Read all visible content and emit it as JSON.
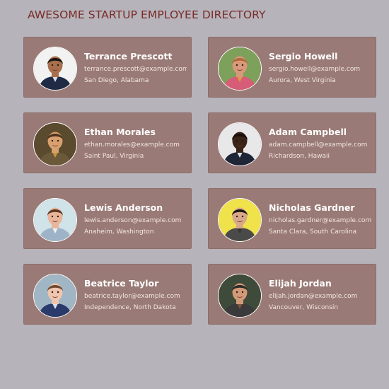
{
  "header": {
    "title": "AWESOME STARTUP EMPLOYEE DIRECTORY"
  },
  "employees": [
    {
      "name": "Terrance Prescott",
      "email": "terrance.prescott@example.com",
      "location": "San Diego, Alabama",
      "photo": {
        "bg": "#f2f2f2",
        "skin": "#a8704e",
        "hair": "#1c1410",
        "shirt": "#1f2a44",
        "accent": "#ffffff"
      }
    },
    {
      "name": "Sergio Howell",
      "email": "sergio.howell@example.com",
      "location": "Aurora, West Virginia",
      "photo": {
        "bg": "#7da05a",
        "skin": "#d9987a",
        "hair": "#b06a3f",
        "shirt": "#d65c78",
        "accent": "#e6a23c"
      }
    },
    {
      "name": "Ethan Morales",
      "email": "ethan.morales@example.com",
      "location": "Saint Paul, Virginia",
      "photo": {
        "bg": "#5a4a2e",
        "skin": "#d8a06e",
        "hair": "#4a3322",
        "shirt": "#6b5a3a",
        "accent": "#d8a23c"
      }
    },
    {
      "name": "Adam Campbell",
      "email": "adam.campbell@example.com",
      "location": "Richardson, Hawaii",
      "photo": {
        "bg": "#e8e8e8",
        "skin": "#3a2418",
        "hair": "#1a100a",
        "shirt": "#1d2536",
        "accent": "#ffffff"
      }
    },
    {
      "name": "Lewis Anderson",
      "email": "lewis.anderson@example.com",
      "location": "Anaheim, Washington",
      "photo": {
        "bg": "#cfe3e8",
        "skin": "#e9b59a",
        "hair": "#5a3a24",
        "shirt": "#9fb3c8",
        "accent": "#ffffff"
      }
    },
    {
      "name": "Nicholas Gardner",
      "email": "nicholas.gardner@example.com",
      "location": "Santa Clara, South Carolina",
      "photo": {
        "bg": "#f0e24a",
        "skin": "#d8a88a",
        "hair": "#201814",
        "shirt": "#4a4a4a",
        "accent": "#333333"
      }
    },
    {
      "name": "Beatrice Taylor",
      "email": "beatrice.taylor@example.com",
      "location": "Independence, North Dakota",
      "photo": {
        "bg": "#a0b6c4",
        "skin": "#efc5ae",
        "hair": "#6e4a30",
        "shirt": "#2a3a6a",
        "accent": "#ffffff"
      }
    },
    {
      "name": "Elijah Jordan",
      "email": "elijah.jordan@example.com",
      "location": "Vancouver, Wisconsin",
      "photo": {
        "bg": "#3e4a3a",
        "skin": "#d29a78",
        "hair": "#2a2a2a",
        "shirt": "#3a3a3a",
        "accent": "#8a5a3a"
      }
    }
  ]
}
